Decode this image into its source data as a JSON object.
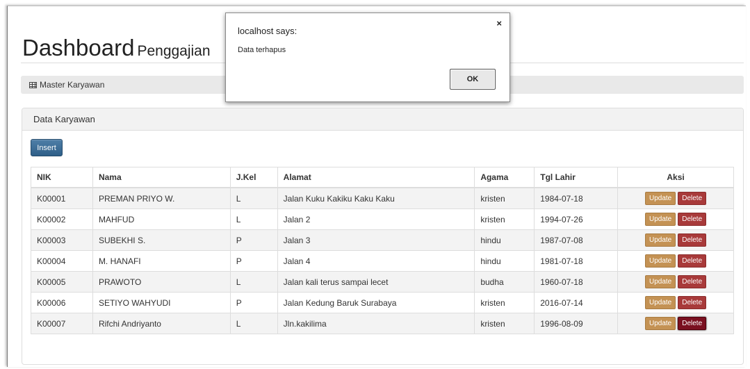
{
  "page": {
    "title": "Dashboard",
    "subtitle": "Penggajian"
  },
  "breadcrumb": {
    "icon": "table-icon",
    "label": "Master Karyawan"
  },
  "panel": {
    "heading": "Data Karyawan",
    "insert_label": "Insert"
  },
  "table": {
    "headers": [
      "NIK",
      "Nama",
      "J.Kel",
      "Alamat",
      "Agama",
      "Tgl Lahir",
      "Aksi"
    ],
    "rows": [
      {
        "nik": "K00001",
        "nama": "PREMAN PRIYO W.",
        "jkel": "L",
        "alamat": "Jalan Kuku Kakiku Kaku Kaku",
        "agama": "kristen",
        "tgl": "1984-07-18"
      },
      {
        "nik": "K00002",
        "nama": "MAHFUD",
        "jkel": "L",
        "alamat": "Jalan 2",
        "agama": "kristen",
        "tgl": "1994-07-26"
      },
      {
        "nik": "K00003",
        "nama": "SUBEKHI S.",
        "jkel": "P",
        "alamat": "Jalan 3",
        "agama": "hindu",
        "tgl": "1987-07-08"
      },
      {
        "nik": "K00004",
        "nama": "M. HANAFI",
        "jkel": "P",
        "alamat": "Jalan 4",
        "agama": "hindu",
        "tgl": "1981-07-18"
      },
      {
        "nik": "K00005",
        "nama": "PRAWOTO",
        "jkel": "L",
        "alamat": "Jalan kali terus sampai lecet",
        "agama": "budha",
        "tgl": "1960-07-18"
      },
      {
        "nik": "K00006",
        "nama": "SETIYO WAHYUDI",
        "jkel": "P",
        "alamat": "Jalan Kedung Baruk Surabaya",
        "agama": "kristen",
        "tgl": "2016-07-14"
      },
      {
        "nik": "K00007",
        "nama": "Rifchi Andriyanto",
        "jkel": "L",
        "alamat": "Jln.kakilima",
        "agama": "kristen",
        "tgl": "1996-08-09"
      }
    ],
    "update_label": "Update",
    "delete_label": "Delete"
  },
  "dialog": {
    "title": "localhost says:",
    "message": "Data terhapus",
    "ok_label": "OK",
    "close_glyph": "×"
  },
  "colors": {
    "insert_button": "#2e5f88",
    "update_button": "#c49254",
    "delete_button": "#a83a3a"
  }
}
